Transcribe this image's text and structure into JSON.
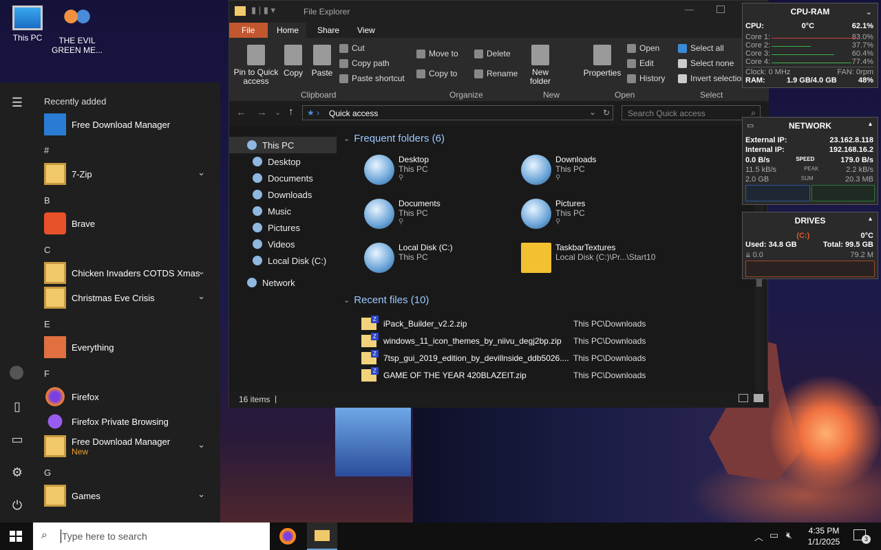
{
  "desktop": {
    "icons": [
      {
        "label": "This PC"
      },
      {
        "label": "THE EVIL GREEN ME..."
      }
    ]
  },
  "start_menu": {
    "recently_added_header": "Recently added",
    "items": [
      {
        "type": "app",
        "label": "Free Download Manager"
      },
      {
        "type": "letter",
        "label": "#"
      },
      {
        "type": "folder",
        "label": "7-Zip"
      },
      {
        "type": "letter",
        "label": "B"
      },
      {
        "type": "app",
        "label": "Brave"
      },
      {
        "type": "letter",
        "label": "C"
      },
      {
        "type": "folder",
        "label": "Chicken Invaders COTDS Xmas"
      },
      {
        "type": "folder",
        "label": "Christmas Eve Crisis"
      },
      {
        "type": "letter",
        "label": "E"
      },
      {
        "type": "app",
        "label": "Everything"
      },
      {
        "type": "letter",
        "label": "F"
      },
      {
        "type": "app",
        "label": "Firefox"
      },
      {
        "type": "app",
        "label": "Firefox Private Browsing"
      },
      {
        "type": "folder",
        "label": "Free Download Manager",
        "sub": "New"
      },
      {
        "type": "letter",
        "label": "G"
      },
      {
        "type": "folder",
        "label": "Games"
      }
    ]
  },
  "explorer": {
    "title": "File Explorer",
    "tabs": [
      "File",
      "Home",
      "Share",
      "View"
    ],
    "ribbon": {
      "pin_to_quick_access": "Pin to Quick access",
      "copy": "Copy",
      "paste": "Paste",
      "cut": "Cut",
      "copy_path": "Copy path",
      "paste_shortcut": "Paste shortcut",
      "move_to": "Move to",
      "copy_to": "Copy to",
      "delete": "Delete",
      "rename": "Rename",
      "new_folder": "New folder",
      "properties": "Properties",
      "open": "Open",
      "edit": "Edit",
      "history": "History",
      "select_all": "Select all",
      "select_none": "Select none",
      "invert_selection": "Invert selection",
      "groups": [
        "Clipboard",
        "Organize",
        "New",
        "Open",
        "Select"
      ]
    },
    "address": {
      "location": "Quick access",
      "search_placeholder": "Search Quick access"
    },
    "nav": [
      "This PC",
      "Desktop",
      "Documents",
      "Downloads",
      "Music",
      "Pictures",
      "Videos",
      "Local Disk (C:)",
      "Network"
    ],
    "frequent_header": "Frequent folders (6)",
    "frequent": [
      {
        "name": "Desktop",
        "sub": "This PC"
      },
      {
        "name": "Downloads",
        "sub": "This PC"
      },
      {
        "name": "Documents",
        "sub": "This PC"
      },
      {
        "name": "Pictures",
        "sub": "This PC"
      },
      {
        "name": "Local Disk (C:)",
        "sub": "This PC"
      },
      {
        "name": "TaskbarTextures",
        "sub": "Local Disk (C:)\\Pr...\\Start10"
      }
    ],
    "recent_header": "Recent files (10)",
    "recent": [
      {
        "name": "iPack_Builder_v2.2.zip",
        "path": "This PC\\Downloads"
      },
      {
        "name": "windows_11_icon_themes_by_niivu_degj2bp.zip",
        "path": "This PC\\Downloads"
      },
      {
        "name": "7tsp_gui_2019_edition_by_devillnside_ddb5026....",
        "path": "This PC\\Downloads"
      },
      {
        "name": "GAME OF THE YEAR 420BLAZEIT.zip",
        "path": "This PC\\Downloads"
      }
    ],
    "status": "16 items"
  },
  "cpu_ram": {
    "title": "CPU-RAM",
    "cpu_label": "CPU:",
    "cpu_temp": "0°C",
    "cpu_pct": "62.1%",
    "cores": [
      {
        "label": "Core 1:",
        "pct": "83.0%",
        "value": 0.83
      },
      {
        "label": "Core 2:",
        "pct": "37.7%",
        "value": 0.377
      },
      {
        "label": "Core 3:",
        "pct": "60.4%",
        "value": 0.604
      },
      {
        "label": "Core 4:",
        "pct": "77.4%",
        "value": 0.774
      }
    ],
    "clock": "Clock: 0 MHz",
    "fan": "FAN: 0rpm",
    "ram_label": "RAM:",
    "ram_value": "1.9 GB/4.0 GB",
    "ram_pct": "48%"
  },
  "network": {
    "title": "NETWORK",
    "external_label": "External IP:",
    "external_ip": "23.162.8.118",
    "internal_label": "Internal IP:",
    "internal_ip": "192.168.16.2",
    "speed_left": "0.0 B/s",
    "speed_label": "SPEED",
    "speed_right": "179.0 B/s",
    "peak_left": "11.5 kB/s",
    "peak_label": "PEAK",
    "peak_right": "2.2 kB/s",
    "sum_left": "2.0 GB",
    "sum_label": "SUM",
    "sum_right": "20.3 MB"
  },
  "drives": {
    "title": "DRIVES",
    "drive": "(C:)",
    "temp": "0°C",
    "used": "Used: 34.8 GB",
    "total": "Total: 99.5 GB",
    "read": "0.0",
    "write": "79.2 M"
  },
  "taskbar": {
    "search_placeholder": "Type here to search",
    "time": "4:35 PM",
    "date": "1/1/2025",
    "notifications": "3"
  },
  "colors": {
    "accent": "#c2572f",
    "link": "#9cc9ff",
    "folder": "#f2c96a"
  }
}
